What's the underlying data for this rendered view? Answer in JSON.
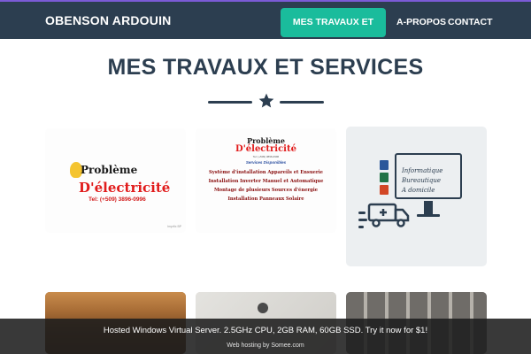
{
  "navbar": {
    "brand": "OBENSON ARDOUIN",
    "links": [
      {
        "label": "MES TRAVAUX ET SERVICES",
        "active": true
      },
      {
        "label": "A-PROPOS",
        "active": false
      },
      {
        "label": "CONTACT",
        "active": false
      }
    ]
  },
  "colors": {
    "navbar_bg": "#2c3e50",
    "accent": "#1abc9c",
    "top_strip": "#7b5bd6",
    "title": "#2c3e50"
  },
  "section": {
    "title": "MES TRAVAUX ET SERVICES",
    "divider_icon": "star-icon"
  },
  "portfolio": [
    {
      "title": "Problème",
      "subtitle": "D'électricité",
      "tel": "Tel: (+509) 3896-0996",
      "credit": "Imprfix BP"
    },
    {
      "title": "Problème",
      "subtitle": "D'électricité",
      "small": "Tel: (+509) 3896-0996",
      "services_heading": "Services Disponibles",
      "lines": [
        "Système d'installation Appareils et Ensuerie",
        "Installation Inverter Manuel et Automatique",
        "Montage de plusieurs Sources d'énergie",
        "Installation Panneaux Solaire"
      ]
    },
    {
      "lines": [
        "Informatique",
        "Bureautique",
        "A domicile"
      ],
      "icons": [
        "word-icon",
        "excel-icon",
        "powerpoint-icon",
        "truck-icon",
        "monitor-icon"
      ]
    },
    {
      "image": "wood-ceiling-photo"
    },
    {
      "image": "wall-socket-photo"
    },
    {
      "image": "wall-panels-photo"
    }
  ],
  "ad": {
    "text": "Hosted Windows Virtual Server. 2.5GHz CPU, 2GB RAM, 60GB SSD. Try it now for $1!",
    "sub": "Web hosting by Somee.com"
  }
}
